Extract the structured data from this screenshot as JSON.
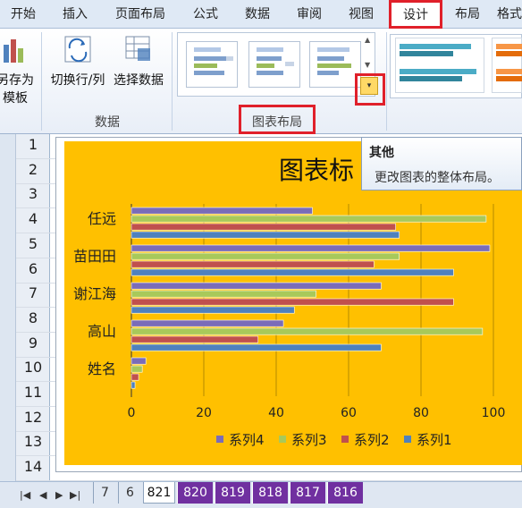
{
  "ribbon_tabs": [
    "开始",
    "插入",
    "页面布局",
    "公式",
    "数据",
    "审阅",
    "视图",
    "设计",
    "布局",
    "格式"
  ],
  "ribbon": {
    "save_as_template": [
      "另存为",
      "模板"
    ],
    "switch_row_col": "切换行/列",
    "select_data": "选择数据",
    "data_group": "数据",
    "chart_layouts_group": "图表布局"
  },
  "tooltip": {
    "title": "其他",
    "body": "更改图表的整体布局。"
  },
  "rows": [
    "1",
    "2",
    "3",
    "4",
    "5",
    "6",
    "7",
    "8",
    "9",
    "10",
    "11",
    "12",
    "13",
    "14"
  ],
  "chart_data": {
    "type": "bar",
    "title": "图表标",
    "categories": [
      "任远",
      "苗田田",
      "谢江海",
      "高山",
      "姓名"
    ],
    "series": [
      {
        "name": "系列4",
        "values": [
          50,
          99,
          69,
          42,
          4
        ]
      },
      {
        "name": "系列3",
        "values": [
          98,
          74,
          51,
          97,
          3
        ]
      },
      {
        "name": "系列2",
        "values": [
          73,
          67,
          89,
          35,
          2
        ]
      },
      {
        "name": "系列1",
        "values": [
          74,
          89,
          45,
          69,
          1
        ]
      }
    ],
    "xticks": [
      "0",
      "20",
      "40",
      "60",
      "80",
      "100"
    ],
    "xlim": [
      0,
      100
    ],
    "legend_position": "bottom",
    "colors": {
      "系列4": "#7a6cb8",
      "系列3": "#a8c95a",
      "系列2": "#c0504d",
      "系列1": "#4f81bd"
    },
    "background": "#ffc000"
  },
  "sheet_tabs": [
    "7",
    "6",
    "821",
    "820",
    "819",
    "818",
    "817",
    "816"
  ],
  "active_sheet": "821",
  "accent": "#e0202a"
}
